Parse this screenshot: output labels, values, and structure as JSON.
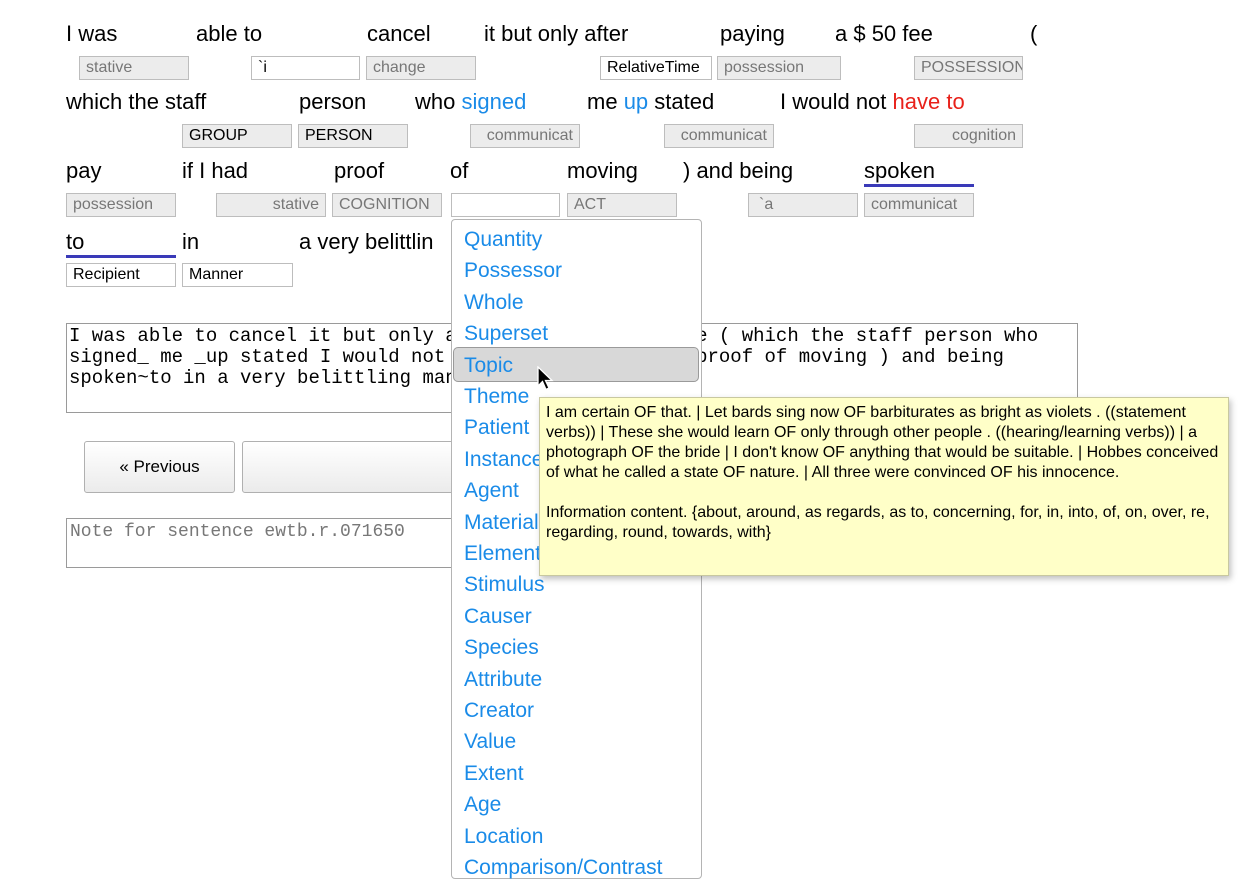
{
  "tokens": [
    {
      "text": "I was"
    },
    {
      "text": "able to"
    },
    {
      "text": "cancel"
    },
    {
      "text": "it but only after"
    },
    {
      "text": "paying"
    },
    {
      "text": "a $ 50 fee"
    },
    {
      "text": "("
    },
    {
      "text": "which the staff"
    },
    {
      "text": "person"
    },
    {
      "text": "who "
    },
    {
      "text": "signed"
    },
    {
      "text": "me "
    },
    {
      "text": "up"
    },
    {
      "text": " stated"
    },
    {
      "text": "I would not "
    },
    {
      "text": "have to"
    },
    {
      "text": "pay"
    },
    {
      "text": "if I had"
    },
    {
      "text": "proof"
    },
    {
      "text": "of"
    },
    {
      "text": "moving"
    },
    {
      "text": ") and being"
    },
    {
      "text": "spoken"
    },
    {
      "text": "to"
    },
    {
      "text": "in"
    },
    {
      "text": "a very belittlin"
    }
  ],
  "tags": [
    "stative",
    "`i",
    "change",
    "RelativeTime",
    "possession",
    "POSSESSION",
    "GROUP",
    "PERSON",
    "communicat",
    "communicat",
    "cognition",
    "possession",
    "stative",
    "COGNITION",
    "",
    "ACT",
    "`a",
    "communicat",
    "Recipient",
    "Manner"
  ],
  "sentence_text": "I was able to cancel it but only after paying a $ 50 fee ( which the staff person who signed_ me _up stated I would not have_to pay if I had proof of moving ) and being spoken~to in a very belittling manner .",
  "buttons": {
    "previous": "« Previous"
  },
  "note_placeholder": "Note for sentence ewtb.r.071650",
  "dropdown_items": [
    "Quantity",
    "Possessor",
    "Whole",
    "Superset",
    "Topic",
    "Theme",
    "Patient",
    "Instance",
    "Agent",
    "Material",
    "Element",
    "Stimulus",
    "Causer",
    "Species",
    "Attribute",
    "Creator",
    "Value",
    "Extent",
    "Age",
    "Location",
    "Comparison/Contrast"
  ],
  "highlighted_item": "Topic",
  "tooltip": {
    "examples": "I am certain OF that. | Let bards sing now OF barbiturates as bright as violets . ((statement verbs)) | These she would learn OF only through other people . ((hearing/learning verbs)) | a photograph OF the bride | I don't know OF anything that would be suitable. | Hobbes conceived of what he called a state OF nature. | All three were convinced OF his innocence.",
    "definition": "Information content. {about, around, as regards, as to, concerning, for, in, into, of, on, over, re, regarding, round, towards, with}"
  },
  "colors": {
    "link_blue": "#1a8be8",
    "mwe_red": "#e8211a",
    "underline": "#3a3ab8",
    "tooltip_bg": "#ffffc8"
  }
}
